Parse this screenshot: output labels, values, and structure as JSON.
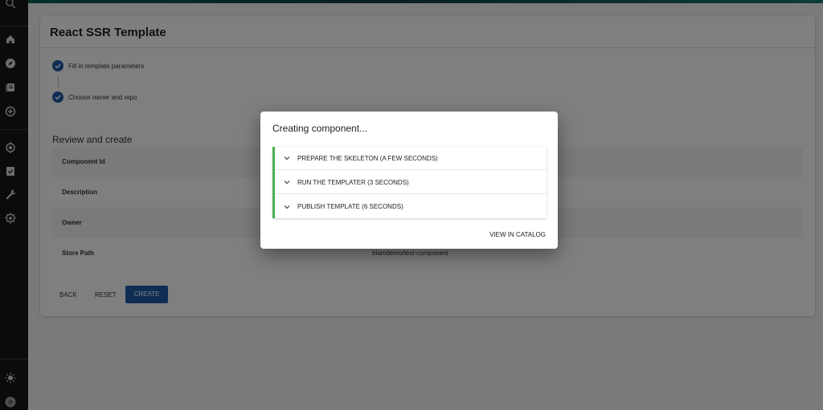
{
  "colors": {
    "primary": "#1f5aa6",
    "success": "#4caf50",
    "sidebar": "#171717"
  },
  "sidebar": {
    "icons": [
      "search-icon",
      "home-icon",
      "explore-icon",
      "docs-icon",
      "create-icon",
      "radar-icon",
      "tasks-icon",
      "tools-icon",
      "settings-icon",
      "theme-icon",
      "profile-icon"
    ]
  },
  "page": {
    "title": "React SSR Template",
    "steps": [
      {
        "label": "Fill in template parameters",
        "done": true
      },
      {
        "label": "Choose owner and repo",
        "done": true
      }
    ],
    "review_title": "Review and create",
    "review_rows": [
      {
        "key": "Component Id",
        "value": ""
      },
      {
        "key": "Description",
        "value": ""
      },
      {
        "key": "Owner",
        "value": ""
      },
      {
        "key": "Store Path",
        "value": "blamdemo/test-component"
      }
    ],
    "buttons": {
      "back": "BACK",
      "reset": "RESET",
      "create": "CREATE"
    }
  },
  "dialog": {
    "title": "Creating component...",
    "steps": [
      {
        "label": "PREPARE THE SKELETON (A FEW SECONDS)"
      },
      {
        "label": "RUN THE TEMPLATER (3 SECONDS)"
      },
      {
        "label": "PUBLISH TEMPLATE (6 SECONDS)"
      }
    ],
    "action": "VIEW IN CATALOG"
  }
}
